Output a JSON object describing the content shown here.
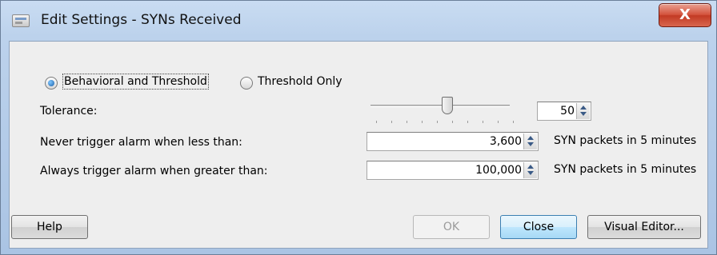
{
  "window": {
    "title": "Edit Settings - SYNs Received",
    "close_glyph": "X",
    "app_icon": "settings-window-icon"
  },
  "mode": {
    "options": [
      {
        "label": "Behavioral and Threshold",
        "selected": true
      },
      {
        "label": "Threshold Only",
        "selected": false
      }
    ]
  },
  "tolerance": {
    "label": "Tolerance:",
    "value": "50",
    "slider_fraction": 0.55
  },
  "never_trigger": {
    "label": "Never trigger alarm when less than:",
    "value": "3,600",
    "unit": "SYN packets in 5 minutes"
  },
  "always_trigger": {
    "label": "Always trigger alarm when greater than:",
    "value": "100,000",
    "unit": "SYN packets in 5 minutes"
  },
  "buttons": {
    "help": "Help",
    "ok": "OK",
    "close": "Close",
    "visual_editor": "Visual Editor..."
  }
}
